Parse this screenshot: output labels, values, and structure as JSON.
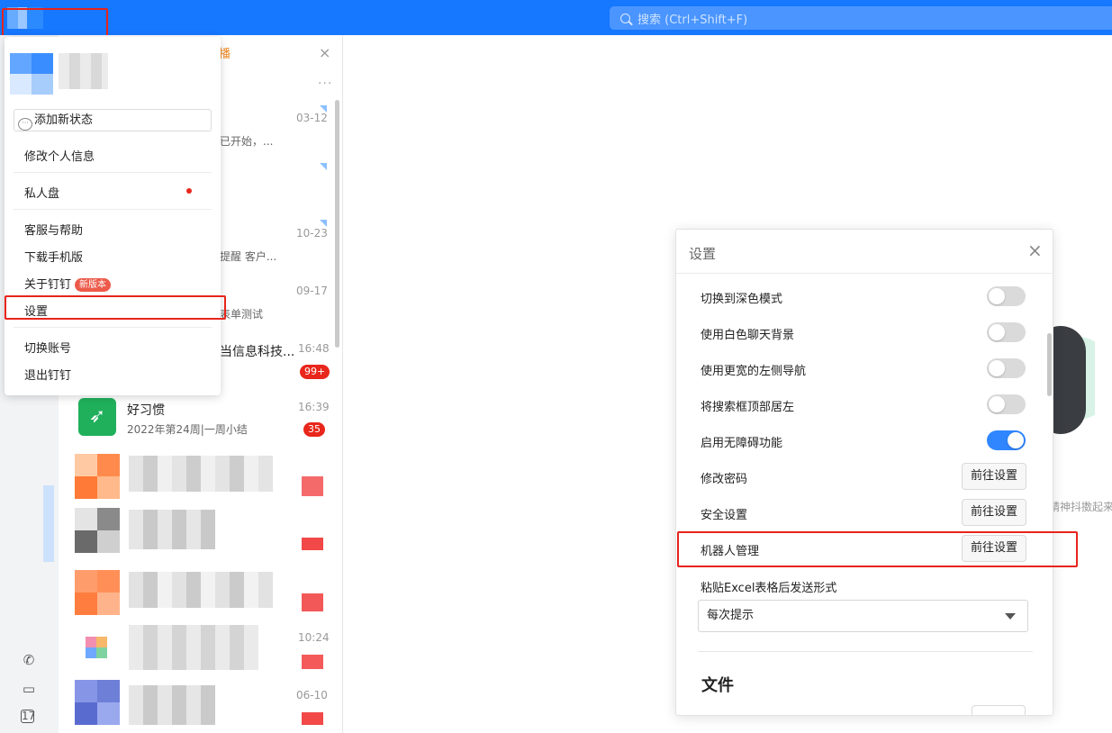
{
  "topbar": {
    "search_placeholder": "搜索 (Ctrl+Shift+F)"
  },
  "profile_menu": {
    "status_button": "添加新状态",
    "items": [
      {
        "label": "修改个人信息"
      },
      {
        "label": "私人盘"
      },
      {
        "label": "客服与帮助"
      },
      {
        "label": "下载手机版"
      },
      {
        "label": "关于钉钉",
        "badge": "新版本"
      },
      {
        "label": "设置"
      },
      {
        "label": "切换账号"
      },
      {
        "label": "退出钉钉"
      }
    ]
  },
  "conversations": {
    "tab_fragment": "播",
    "visible": [
      {
        "date": "03-12",
        "preview": "已开始，..."
      },
      {
        "date": "10-23",
        "preview": "提醒 客户..."
      },
      {
        "date": "09-17",
        "preview": "表单测试"
      },
      {
        "date": "16:48",
        "name_fragment": "当信息科技...",
        "badge": "99+"
      },
      {
        "date": "16:39",
        "name": "好习惯",
        "preview": "2022年第24周|一周小结",
        "badge": "35"
      },
      {
        "date": "10:24"
      },
      {
        "date": "06-10"
      }
    ]
  },
  "right_panel": {
    "hint_fragment": "精神抖擞起来"
  },
  "settings_dialog": {
    "title": "设置",
    "toggles": [
      {
        "label": "切换到深色模式",
        "on": false
      },
      {
        "label": "使用白色聊天背景",
        "on": false
      },
      {
        "label": "使用更宽的左侧导航",
        "on": false
      },
      {
        "label": "将搜索框顶部居左",
        "on": false
      },
      {
        "label": "启用无障碍功能",
        "on": true
      }
    ],
    "buttons": [
      {
        "label": "修改密码",
        "button": "前往设置"
      },
      {
        "label": "安全设置",
        "button": "前往设置"
      },
      {
        "label": "机器人管理",
        "button": "前往设置"
      }
    ],
    "excel_label": "粘贴Excel表格后发送形式",
    "excel_value": "每次提示",
    "section_file": "文件"
  },
  "colors": {
    "brand_blue": "#1677ff",
    "highlight_red": "#e8241c",
    "toggle_on": "#2f86ff",
    "badge_red": "#e9261b"
  }
}
